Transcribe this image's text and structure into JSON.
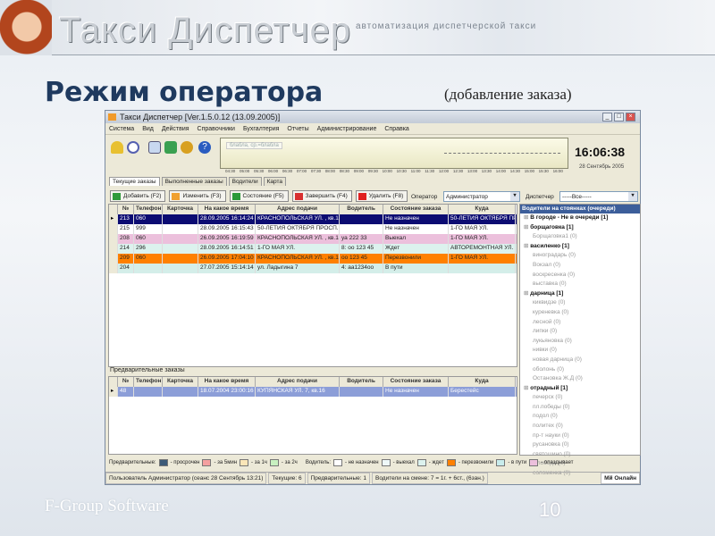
{
  "slide": {
    "brand": "Такси Диспетчер",
    "tagline": "автоматизация диспетчерской такси",
    "title": "Режим оператора",
    "subtitle": "(добавление заказа)",
    "footer": "F-Group Software",
    "page": "10"
  },
  "window": {
    "title": "Такси Диспетчер [Ver.1.5.0.12  (13.09.2005)]",
    "menu": [
      "Система",
      "Вид",
      "Действия",
      "Справочники",
      "Бухгалтерия",
      "Отчеты",
      "Администрирование",
      "Справка"
    ],
    "graph_hint": "блабла, ср.=блабла",
    "axis": [
      "04:30",
      "05:00",
      "05:30",
      "06:00",
      "06:30",
      "07:00",
      "07:30",
      "08:00",
      "08:30",
      "09:00",
      "09:30",
      "10:00",
      "10:30",
      "11:00",
      "11:30",
      "12:00",
      "12:30",
      "13:00",
      "13:30",
      "14:00",
      "14:30",
      "15:00",
      "15:30",
      "16:00"
    ],
    "clock": "16:06:38",
    "date": "28 Сентябрь 2005",
    "tabs": [
      "Текущие заказы",
      "Выполненные заказы",
      "Водители",
      "Карта"
    ],
    "buttons": [
      {
        "label": "Добавить (F2)",
        "color": "#2e9a3a"
      },
      {
        "label": "Изменить (F3)",
        "color": "#f0a030"
      },
      {
        "label": "Состояние (F5)",
        "color": "#2a9a3a"
      },
      {
        "label": "Завершить (F4)",
        "color": "#d83030"
      },
      {
        "label": "Удалить (F8)",
        "color": "#e02020"
      }
    ],
    "operator_label": "Оператор",
    "operator_value": "Администратор",
    "dispatcher_label": "Диспетчер",
    "dispatcher_value": "-----Все-----",
    "columns": [
      "№",
      "Телефон",
      "Карточка",
      "На какое время",
      "Адрес подачи",
      "Водитель",
      "Состояние заказа",
      "Куда"
    ],
    "orders": [
      {
        "cells": [
          "213",
          "060",
          "",
          "28.09.2005 16:14:24",
          "КРАСНОПОЛЬСКАЯ УЛ. , кв.1",
          "",
          "Не назначен",
          "50-ЛЕТИЯ ОКТЯБРЯ ПРОСП."
        ],
        "bg": "#0c0c72",
        "fg": "#ffffff"
      },
      {
        "cells": [
          "215",
          "999",
          "",
          "28.09.2005 16:15:43",
          "50-ЛЕТИЯ ОКТЯБРЯ ПРОСП.",
          "",
          "Не назначен",
          "1-ГО МАЯ УЛ."
        ],
        "bg": "#ffffff",
        "fg": "#222222"
      },
      {
        "cells": [
          "208",
          "060",
          "",
          "26.09.2005 16:19:59",
          "КРАСНОПОЛЬСКАЯ УЛ. , кв.14",
          "уа 222 33",
          "Выехал",
          "1-ГО МАЯ УЛ."
        ],
        "bg": "#ecc0dc",
        "fg": "#222222"
      },
      {
        "cells": [
          "214",
          "296",
          "",
          "28.09.2005 16:14:51",
          "1-ГО МАЯ УЛ.",
          "8: оо 123 45",
          "Ждет",
          "АВТОРЕМОНТНАЯ УЛ."
        ],
        "bg": "#dcf2ee",
        "fg": "#222222"
      },
      {
        "cells": [
          "209",
          "060",
          "",
          "26.09.2005 17:04:10",
          "КРАСНОПОЛЬСКАЯ УЛ. , кв.18",
          "оо 123 45",
          "Перезвонили",
          "1-ГО МАЯ УЛ."
        ],
        "bg": "#ff8000",
        "fg": "#222222"
      },
      {
        "cells": [
          "204",
          "",
          "",
          "27.07.2005 15:14:14",
          "ул. Ладыгина 7",
          "4: аа1234оо",
          "В пути",
          ""
        ],
        "bg": "#d4eee9",
        "fg": "#222222"
      }
    ],
    "prelim_title": "Предварительные заказы",
    "prelim_orders": [
      {
        "cells": [
          "48",
          "",
          "",
          "18.07.2004 23:00:16",
          "КУПЯНСКАЯ УЛ. 7, кв.16",
          "",
          "Не назначен",
          "Берестейс"
        ],
        "bg": "#8c9ed8",
        "fg": "#ffffff"
      }
    ],
    "tree_title": "Водители на стоянках (очереди)",
    "tree": [
      {
        "t": "В городе - Не в очереди [1]",
        "g": true
      },
      {
        "t": "борщаговка [1]",
        "g": true
      },
      {
        "t": "Борщаговка1 (0)"
      },
      {
        "t": "василенко [1]",
        "g": true
      },
      {
        "t": "виноградарь (0)"
      },
      {
        "t": "Вокзал (0)"
      },
      {
        "t": "воскресенка (0)"
      },
      {
        "t": "выставка (0)"
      },
      {
        "t": "дарница [1]",
        "g": true
      },
      {
        "t": "киквидзе (0)"
      },
      {
        "t": "куреневка (0)"
      },
      {
        "t": "лесной (0)"
      },
      {
        "t": "липки (0)"
      },
      {
        "t": "лукьяновка (0)"
      },
      {
        "t": "нивки (0)"
      },
      {
        "t": "новая дарница (0)"
      },
      {
        "t": "оболонь (0)"
      },
      {
        "t": "Остановка Ж.Д (0)"
      },
      {
        "t": "отрадный [1]",
        "g": true
      },
      {
        "t": "печерск (0)"
      },
      {
        "t": "пл.победы (0)"
      },
      {
        "t": "подол (0)"
      },
      {
        "t": "политех (0)"
      },
      {
        "t": "пр-т науки (0)"
      },
      {
        "t": "русановка (0)"
      },
      {
        "t": "святошино (0)"
      },
      {
        "t": "Слобода (0)"
      },
      {
        "t": "соломенка (0)"
      }
    ],
    "legend": {
      "prelim_label": "Предварительные:",
      "prelim": [
        {
          "t": "- просрочен",
          "c": "#3c5a78"
        },
        {
          "t": "- за 5мин",
          "c": "#f4a0a0"
        },
        {
          "t": "- за 1ч",
          "c": "#fbe6b8"
        },
        {
          "t": "- за 2ч",
          "c": "#c8f0c0"
        }
      ],
      "driver_label": "Водитель:",
      "driver": [
        {
          "t": "- не назначен",
          "c": "#ffffff"
        },
        {
          "t": "- выехал",
          "c": "#eef8f8"
        },
        {
          "t": "- ждет",
          "c": "#dcf2ee"
        },
        {
          "t": "- перезвонили",
          "c": "#ff8000"
        },
        {
          "t": "- в пути",
          "c": "#c8ecec"
        },
        {
          "t": "- опаздывает",
          "c": "#ecc0dc"
        }
      ]
    },
    "status": [
      "Пользователь Администратор  (сеанс 28 Сентябрь  13:21)",
      "Текущие: 6",
      "Предварительные: 1",
      "Водители на смене: 7 = 1г. + 6ст., (6зан.)",
      "Мй Онлайн"
    ]
  }
}
